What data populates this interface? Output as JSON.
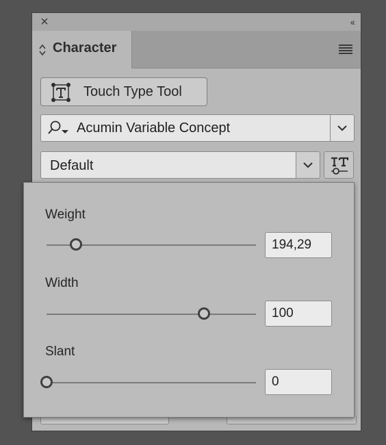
{
  "panel": {
    "title": "Character",
    "close_icon": "close-icon",
    "collapse_icon": "double-chevron-left-icon",
    "menu_icon": "hamburger-menu-icon"
  },
  "touch_type": {
    "label": "Touch Type Tool",
    "icon": "touch-type-icon"
  },
  "font": {
    "family": "Acumin Variable Concept",
    "search_icon": "search-dropdown-icon",
    "dropdown_icon": "chevron-down-icon"
  },
  "style": {
    "value": "Default",
    "dropdown_icon": "chevron-down-icon",
    "variable_font_icon": "variable-font-icon"
  },
  "variable_axes": [
    {
      "label": "Weight",
      "value": "194,29",
      "level": 0.14
    },
    {
      "label": "Width",
      "value": "100",
      "level": 0.75
    },
    {
      "label": "Slant",
      "value": "0",
      "level": 0.0
    }
  ],
  "colors": {
    "panel_bg": "#b8b8b8",
    "field_bg": "#e6e6e6",
    "text": "#262626"
  }
}
